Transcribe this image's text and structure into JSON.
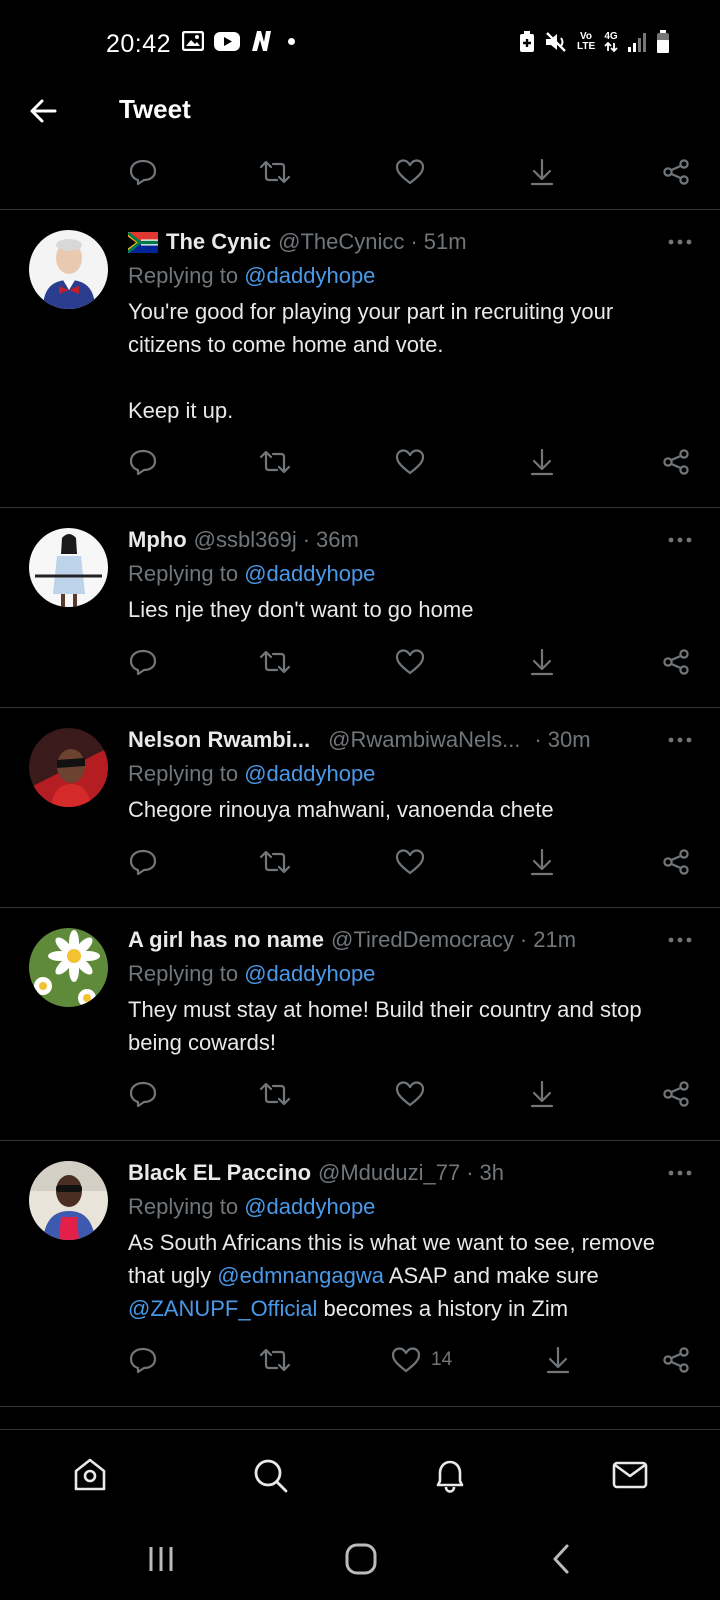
{
  "status_bar": {
    "time": "20:42",
    "left_icons": [
      "gallery-icon",
      "youtube-icon",
      "netflix-icon"
    ],
    "right_icons": [
      "battery-saver-icon",
      "mute-icon",
      "volte-icon",
      "4g-icon",
      "signal-icon",
      "battery-icon"
    ],
    "volte_label": "Vo LTE",
    "network_label": "4G"
  },
  "header": {
    "title": "Tweet"
  },
  "tweets": [
    {
      "name": "The Cynic",
      "handle": "@TheCynicc",
      "time": "51m",
      "has_flag": true,
      "replying_prefix": "Replying to",
      "replying_to": "@daddyhope",
      "body": [
        "You're good for playing your part in recruiting your citizens to come home and vote.",
        "Keep it up."
      ],
      "like_count": ""
    },
    {
      "name": "Mpho",
      "handle": "@ssbl369j",
      "time": "36m",
      "replying_prefix": "Replying to",
      "replying_to": "@daddyhope",
      "body": [
        "Lies nje they don't want to go home"
      ],
      "like_count": ""
    },
    {
      "name": "Nelson Rwambi...",
      "handle": "@RwambiwaNels...",
      "time": "30m",
      "replying_prefix": "Replying to",
      "replying_to": "@daddyhope",
      "body": [
        "Chegore rinouya mahwani, vanoenda chete"
      ],
      "like_count": ""
    },
    {
      "name": "A girl has no name",
      "handle": "@TiredDemocracy",
      "time": "21m",
      "replying_prefix": "Replying to",
      "replying_to": "@daddyhope",
      "body": [
        "They must stay at home! Build their country and stop being cowards!"
      ],
      "like_count": ""
    },
    {
      "name": "Black EL Paccino",
      "handle": "@Mduduzi_77",
      "time": "3h",
      "replying_prefix": "Replying to",
      "replying_to": "@daddyhope",
      "body_parts": {
        "p1": "As South Africans this is what we want to see, remove that ugly ",
        "m1": "@edmnangagwa",
        "p2": " ASAP and make sure ",
        "m2": "@ZANUPF_Official",
        "p3": " becomes a history in Zim"
      },
      "like_count": "14"
    }
  ],
  "bottom_nav": [
    "home-icon",
    "search-icon",
    "notifications-icon",
    "messages-icon"
  ],
  "system_nav": [
    "recents-icon",
    "home-circle-icon",
    "back-chevron-icon"
  ]
}
